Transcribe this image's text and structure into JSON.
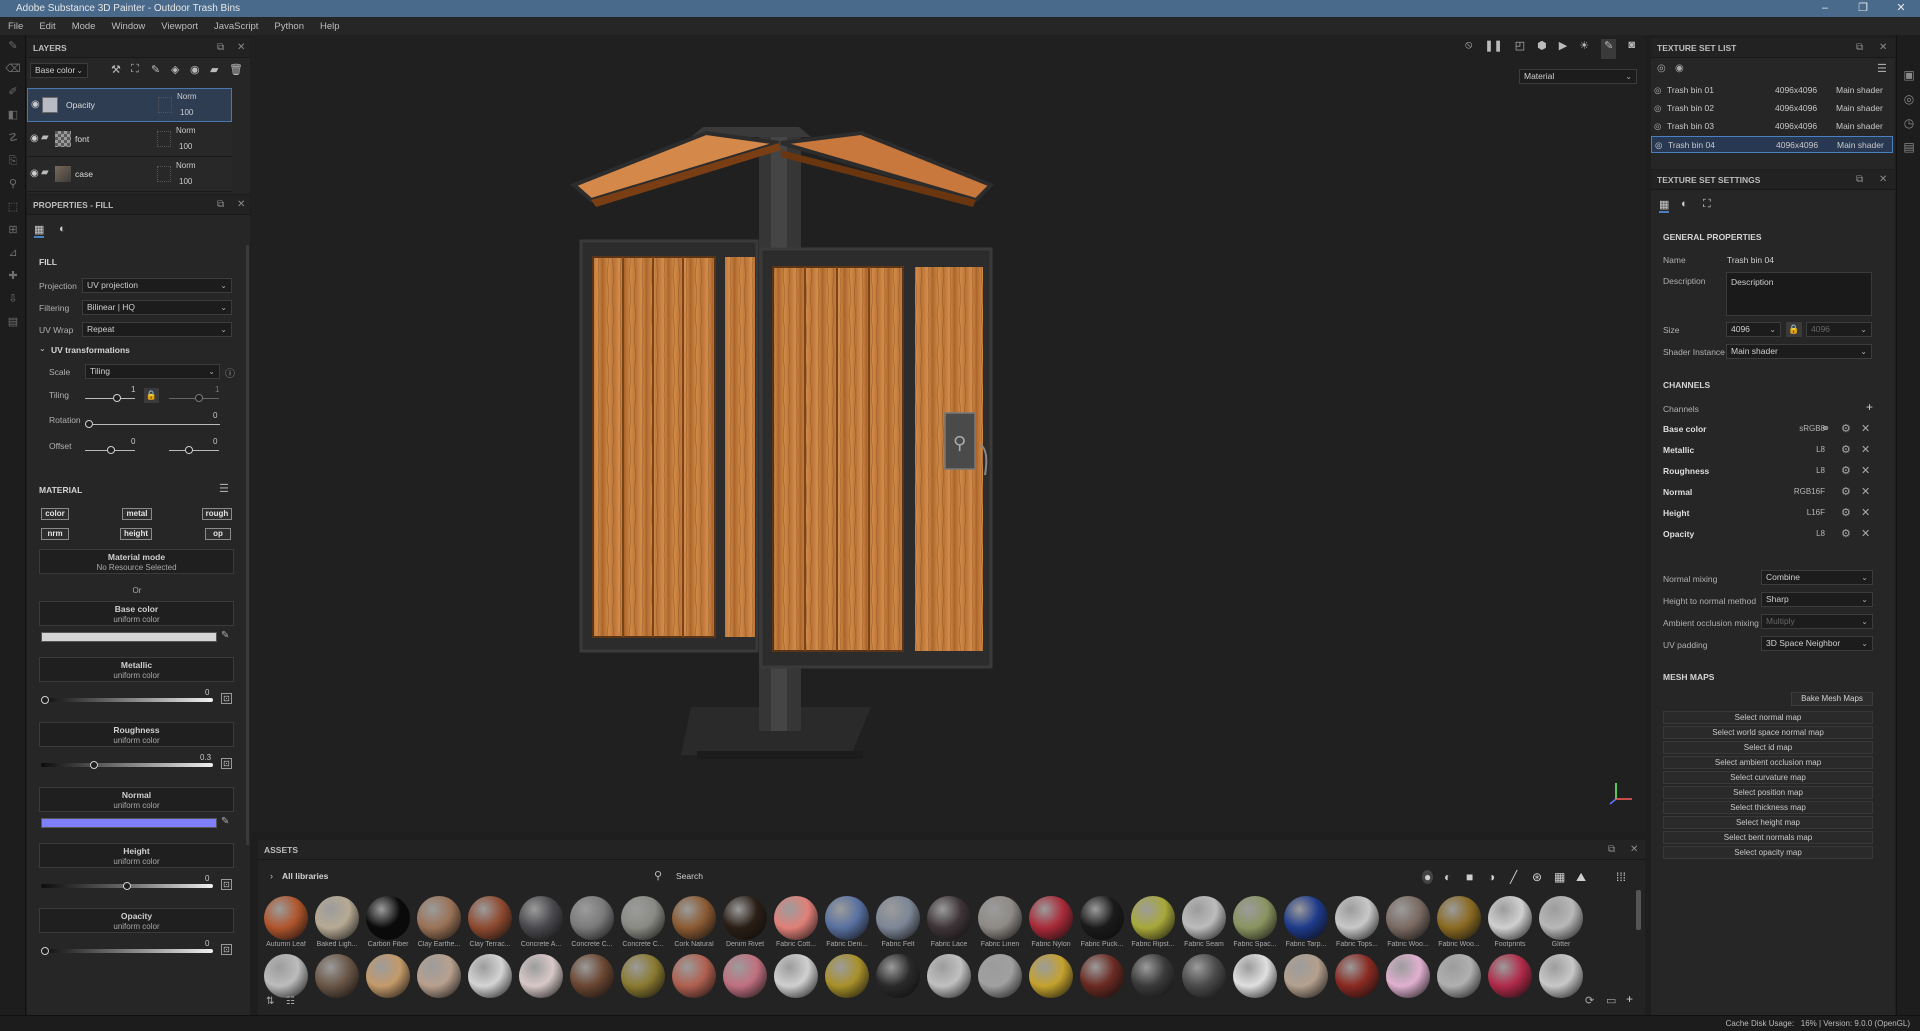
{
  "window": {
    "title": "Adobe Substance 3D Painter - Outdoor Trash Bins",
    "min": "–",
    "max": "❐",
    "close": "✕"
  },
  "menu": [
    "File",
    "Edit",
    "Mode",
    "Window",
    "Viewport",
    "JavaScript",
    "Python",
    "Help"
  ],
  "layers": {
    "title": "LAYERS",
    "channel": "Base color",
    "items": [
      {
        "name": "Opacity",
        "blend": "Norm",
        "opacity": "100",
        "selected": true
      },
      {
        "name": "font",
        "blend": "Norm",
        "opacity": "100",
        "selected": false
      },
      {
        "name": "case",
        "blend": "Norm",
        "opacity": "100",
        "selected": false
      }
    ]
  },
  "properties": {
    "title": "PROPERTIES - FILL",
    "fill_label": "FILL",
    "projection_label": "Projection",
    "projection": "UV projection",
    "filtering_label": "Filtering",
    "filtering": "Bilinear | HQ",
    "uvwrap_label": "UV Wrap",
    "uvwrap": "Repeat",
    "uvt_label": "UV transformations",
    "scale_label": "Scale",
    "scale": "Tiling",
    "tiling_label": "Tiling",
    "tiling_value": "1",
    "tiling_value2": "1",
    "rotation_label": "Rotation",
    "rotation_value": "0",
    "offset_label": "Offset",
    "offset_value": "0",
    "offset_value2": "0",
    "material_label": "MATERIAL",
    "chips": [
      "color",
      "metal",
      "rough",
      "nrm",
      "height",
      "op"
    ],
    "material_mode_title": "Material mode",
    "material_mode_sub": "No Resource Selected",
    "or_label": "Or",
    "channels": [
      {
        "name": "Base color",
        "sub": "uniform color",
        "kind": "color",
        "color": "#d4d4d4"
      },
      {
        "name": "Metallic",
        "sub": "uniform color",
        "kind": "slider",
        "value": "0",
        "fraction": 0.0
      },
      {
        "name": "Roughness",
        "sub": "uniform color",
        "kind": "slider",
        "value": "0.3",
        "fraction": 0.3
      },
      {
        "name": "Normal",
        "sub": "uniform color",
        "kind": "color",
        "color": "#8080ff"
      },
      {
        "name": "Height",
        "sub": "uniform color",
        "kind": "slider",
        "value": "0",
        "fraction": 0.5
      },
      {
        "name": "Opacity",
        "sub": "uniform color",
        "kind": "slider",
        "value": "0",
        "fraction": 0.0
      }
    ]
  },
  "viewport": {
    "mode_dropdown": "Material"
  },
  "texture_set_list": {
    "title": "TEXTURE SET LIST",
    "items": [
      {
        "name": "Trash bin 01",
        "size": "4096x4096",
        "shader": "Main shader",
        "selected": false
      },
      {
        "name": "Trash bin 02",
        "size": "4096x4096",
        "shader": "Main shader",
        "selected": false
      },
      {
        "name": "Trash bin 03",
        "size": "4096x4096",
        "shader": "Main shader",
        "selected": false
      },
      {
        "name": "Trash bin 04",
        "size": "4096x4096",
        "shader": "Main shader",
        "selected": true
      }
    ]
  },
  "texture_set_settings": {
    "title": "TEXTURE SET SETTINGS",
    "general_label": "GENERAL PROPERTIES",
    "name_label": "Name",
    "name": "Trash bin 04",
    "description_label": "Description",
    "description_placeholder": "Description",
    "size_label": "Size",
    "size": "4096",
    "size_linked": "4096",
    "shader_label": "Shader Instance",
    "shader": "Main shader",
    "channels_label": "CHANNELS",
    "channels_sub": "Channels",
    "channels": [
      {
        "name": "Base color",
        "format": "sRGB8"
      },
      {
        "name": "Metallic",
        "format": "L8"
      },
      {
        "name": "Roughness",
        "format": "L8"
      },
      {
        "name": "Normal",
        "format": "RGB16F"
      },
      {
        "name": "Height",
        "format": "L16F"
      },
      {
        "name": "Opacity",
        "format": "L8"
      }
    ],
    "normal_mixing_label": "Normal mixing",
    "normal_mixing": "Combine",
    "h2n_label": "Height to normal method",
    "h2n": "Sharp",
    "ao_label": "Ambient occlusion mixing",
    "ao": "Multiply",
    "uvpad_label": "UV padding",
    "uvpad": "3D Space Neighbor",
    "meshmaps_label": "MESH MAPS",
    "bake_button": "Bake Mesh Maps",
    "mesh_maps": [
      "Select normal map",
      "Select world space normal map",
      "Select id map",
      "Select ambient occlusion map",
      "Select curvature map",
      "Select position map",
      "Select thickness map",
      "Select height map",
      "Select bent normals map",
      "Select opacity map"
    ]
  },
  "assets": {
    "title": "ASSETS",
    "library": "All libraries",
    "search_placeholder": "Search",
    "row1": [
      {
        "label": "Autumn Leaf",
        "color": "#b0552c"
      },
      {
        "label": "Baked Ligh...",
        "color": "#b7aa94"
      },
      {
        "label": "Carbon Fiber",
        "color": "#0a0a0a"
      },
      {
        "label": "Clay Earthe...",
        "color": "#9a7256"
      },
      {
        "label": "Clay Terrac...",
        "color": "#8e4a30"
      },
      {
        "label": "Concrete A...",
        "color": "#4a4a4e"
      },
      {
        "label": "Concrete C...",
        "color": "#7a7a7a"
      },
      {
        "label": "Concrete C...",
        "color": "#8a8a84"
      },
      {
        "label": "Cork Natural",
        "color": "#8a5a32"
      },
      {
        "label": "Denim Rivet",
        "color": "#2a1e16"
      },
      {
        "label": "Fabric Cott...",
        "color": "#e08078"
      },
      {
        "label": "Fabric Deni...",
        "color": "#5870a0"
      },
      {
        "label": "Fabric Felt",
        "color": "#7c8696"
      },
      {
        "label": "Fabric Lace",
        "color": "#3e3438"
      },
      {
        "label": "Fabric Linen",
        "color": "#8e8a86"
      },
      {
        "label": "Fabric Nylon",
        "color": "#a82a38"
      },
      {
        "label": "Fabric Puck...",
        "color": "#1a1a1a"
      },
      {
        "label": "Fabric Ripst...",
        "color": "#a8a83a"
      },
      {
        "label": "Fabric Seam",
        "color": "#bcbcbc"
      },
      {
        "label": "Fabric Spac...",
        "color": "#8a9460"
      },
      {
        "label": "Fabric Tarp...",
        "color": "#1e3a8a"
      },
      {
        "label": "Fabric Tops...",
        "color": "#c8c8c8"
      },
      {
        "label": "Fabric Woo...",
        "color": "#7a6a62"
      },
      {
        "label": "Fabric Woo...",
        "color": "#8a6a22"
      },
      {
        "label": "Footprints",
        "color": "#d0d0d0"
      },
      {
        "label": "Glitter",
        "color": "#b8b8b8"
      }
    ],
    "row2": [
      "#bcbcbc",
      "#6a5646",
      "#c49a6a",
      "#b8a08e",
      "#d4d4d4",
      "#d8c8c8",
      "#6a4632",
      "#8a7a30",
      "#b06050",
      "#c07080",
      "#d0d0d0",
      "#a8902a",
      "#2a2a2a",
      "#c0c0c0",
      "#a0a0a0",
      "#c4a22e",
      "#6a2a22",
      "#3a3a3a",
      "#4a4a4a",
      "#e0e0e0",
      "#b4a08e",
      "#8a2a22",
      "#e0b0d0",
      "#b0b0b0",
      "#b02a4a",
      "#c8c8c8"
    ]
  },
  "status": {
    "text": "Cache Disk Usage:   16% | Version: 9.0.0 (OpenGL)"
  }
}
